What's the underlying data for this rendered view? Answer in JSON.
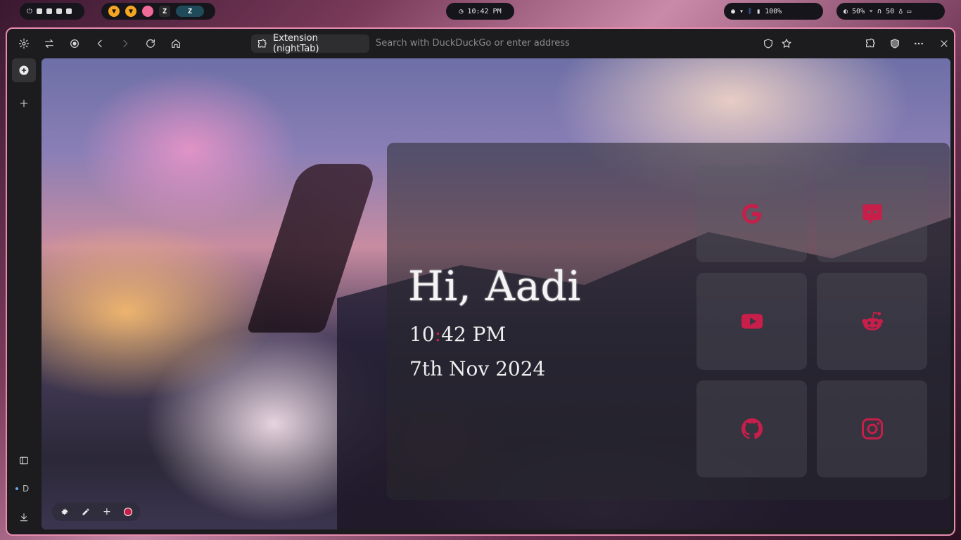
{
  "system_bar": {
    "clock": "10:42 PM",
    "battery": "100%",
    "brightness": "50%",
    "volume": "50"
  },
  "browser": {
    "active_tab_label": "Extension (nightTab)",
    "address_placeholder": "Search with DuckDuckGo or enter address",
    "sidebar_workspace": "D"
  },
  "newtab": {
    "greeting": "Hi, Aadi",
    "time_hours": "10",
    "time_sep": ":",
    "time_rest": "42 PM",
    "date": "7th Nov 2024",
    "accent_color": "#c81e4a",
    "bookmarks": [
      {
        "name": "google",
        "icon": "google-icon"
      },
      {
        "name": "discord",
        "icon": "discord-icon"
      },
      {
        "name": "youtube",
        "icon": "youtube-icon"
      },
      {
        "name": "reddit",
        "icon": "reddit-icon"
      },
      {
        "name": "github",
        "icon": "github-icon"
      },
      {
        "name": "instagram",
        "icon": "instagram-icon"
      }
    ]
  }
}
